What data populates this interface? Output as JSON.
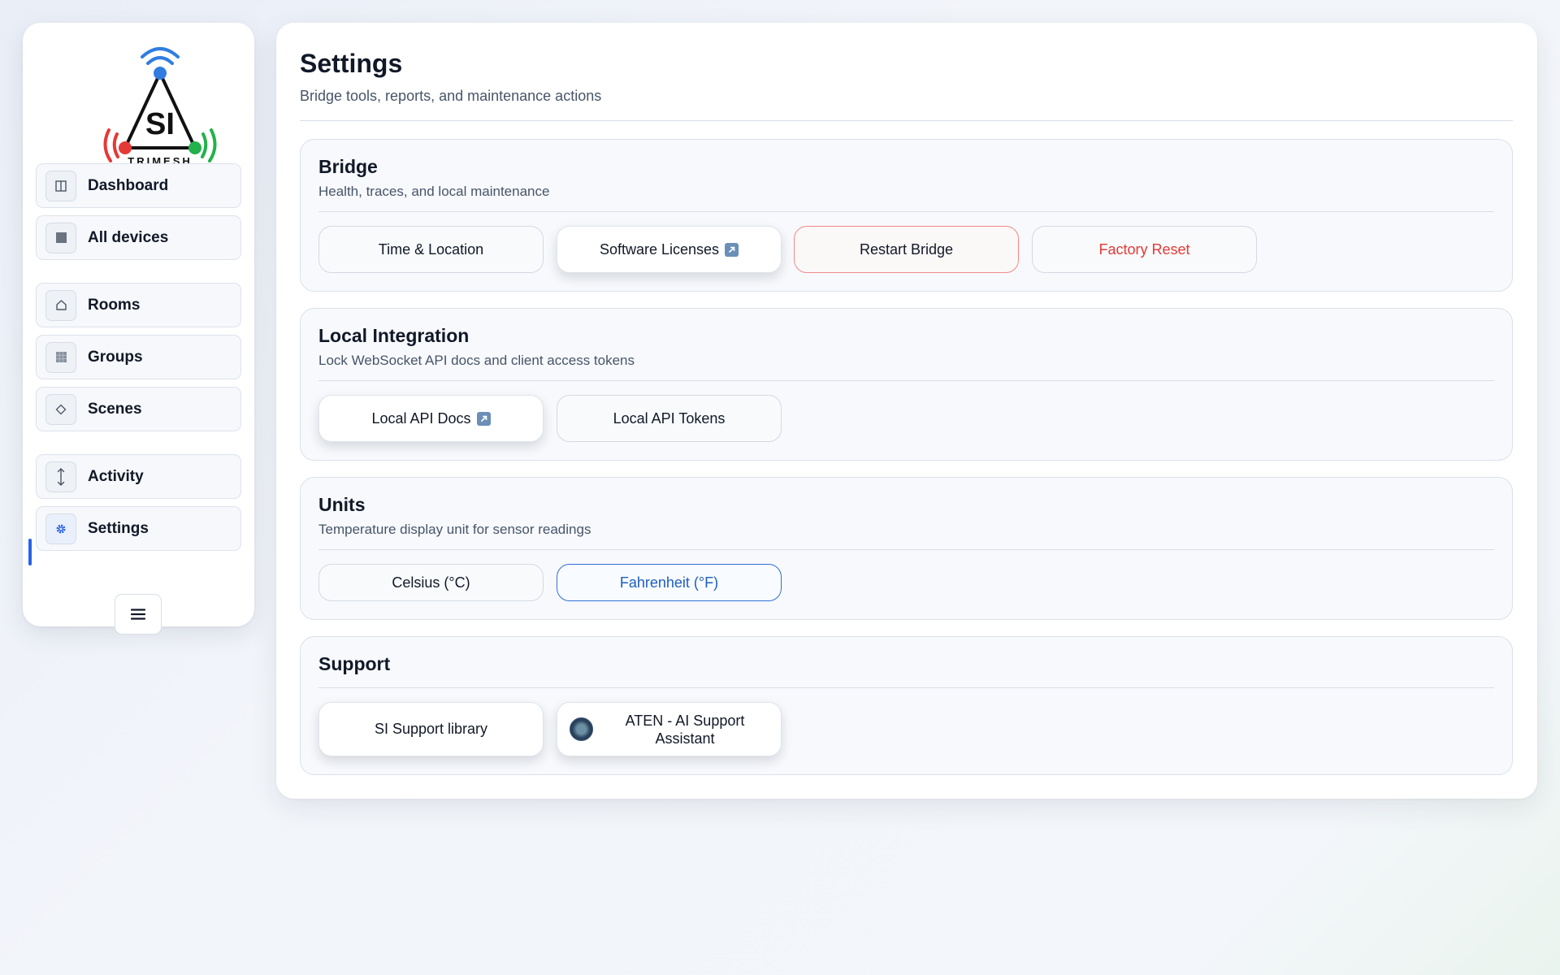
{
  "brand": {
    "logo_text": "SI",
    "logo_subtext": "TRIMESH"
  },
  "sidebar": {
    "items": [
      {
        "label": "Dashboard",
        "icon": "columns-icon"
      },
      {
        "label": "All devices",
        "icon": "square-icon"
      },
      {
        "label": "Rooms",
        "icon": "home-icon"
      },
      {
        "label": "Groups",
        "icon": "grid-icon"
      },
      {
        "label": "Scenes",
        "icon": "diamond-icon"
      },
      {
        "label": "Activity",
        "icon": "vertical-arrows-icon"
      },
      {
        "label": "Settings",
        "icon": "gear-icon",
        "active": true
      }
    ],
    "menu_icon": "hamburger-icon"
  },
  "page": {
    "title": "Settings",
    "subtitle": "Bridge tools, reports, and maintenance actions"
  },
  "sections": {
    "bridge": {
      "title": "Bridge",
      "description": "Health, traces, and local maintenance",
      "buttons": {
        "time_location": "Time & Location",
        "software_licenses": "Software Licenses",
        "restart_bridge": "Restart Bridge",
        "factory_reset": "Factory Reset"
      }
    },
    "local_integration": {
      "title": "Local Integration",
      "description": "Lock WebSocket API docs and client access tokens",
      "buttons": {
        "local_api_docs": "Local API Docs",
        "local_api_tokens": "Local API Tokens"
      }
    },
    "units": {
      "title": "Units",
      "description": "Temperature display unit for sensor readings",
      "options": {
        "celsius": "Celsius (°C)",
        "fahrenheit": "Fahrenheit (°F)"
      },
      "selected": "fahrenheit"
    },
    "support": {
      "title": "Support",
      "buttons": {
        "support_library": "SI Support library",
        "aten_assistant": "ATEN - AI Support Assistant"
      }
    }
  },
  "colors": {
    "accent": "#2563eb",
    "danger": "#e53935",
    "logo_blue": "#2f7de1",
    "logo_red": "#e53935",
    "logo_green": "#22b14c"
  }
}
